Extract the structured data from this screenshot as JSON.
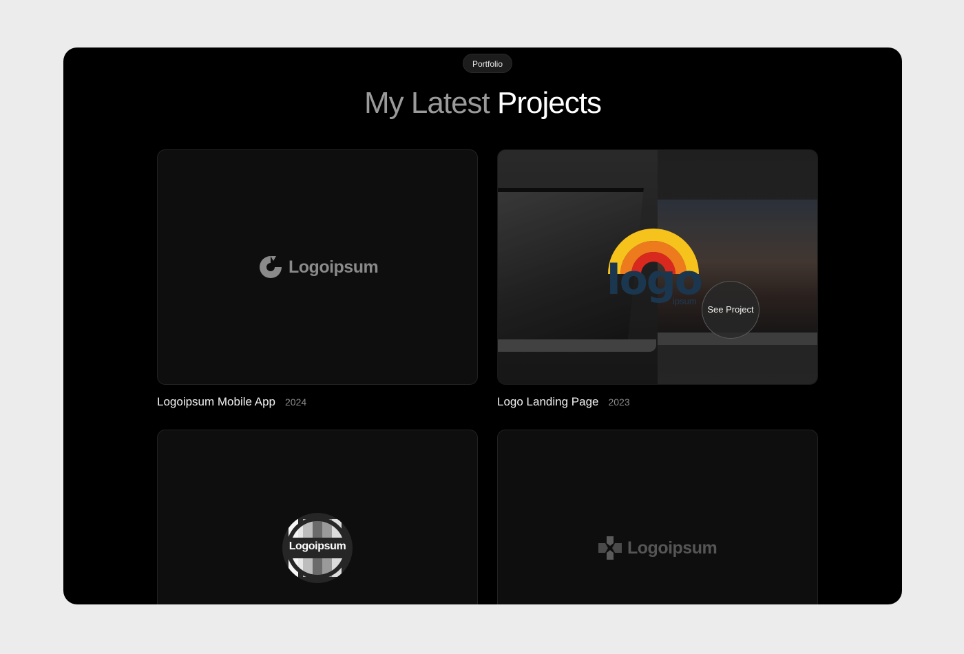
{
  "section": {
    "badge": "Portfolio",
    "title_muted": "My Latest",
    "title_bright": "Projects"
  },
  "projects": [
    {
      "title": "Logoipsum Mobile App",
      "year": "2024",
      "logo_text": "Logoipsum",
      "logo_icon": "donut-logo-icon"
    },
    {
      "title": "Logo Landing Page",
      "year": "2023",
      "logo_text": "logo",
      "logo_sub": "ipsum",
      "cta": "See Project",
      "logo_icon": "rainbow-arc-logo-icon"
    },
    {
      "title": "",
      "year": "",
      "logo_text": "Logoipsum",
      "logo_icon": "circle-badge-logo-icon"
    },
    {
      "title": "",
      "year": "",
      "logo_text": "Logoipsum",
      "logo_icon": "flower-logo-icon"
    }
  ],
  "colors": {
    "page_bg": "#ececec",
    "frame_bg": "#000000",
    "card_bg": "#0e0e0e",
    "title_muted": "#9a9a9a",
    "title_bright": "#ffffff",
    "logo_navy": "#1b3750",
    "arc_yellow": "#f6c21c",
    "arc_orange": "#ee7a1e",
    "arc_red": "#d9281e"
  }
}
